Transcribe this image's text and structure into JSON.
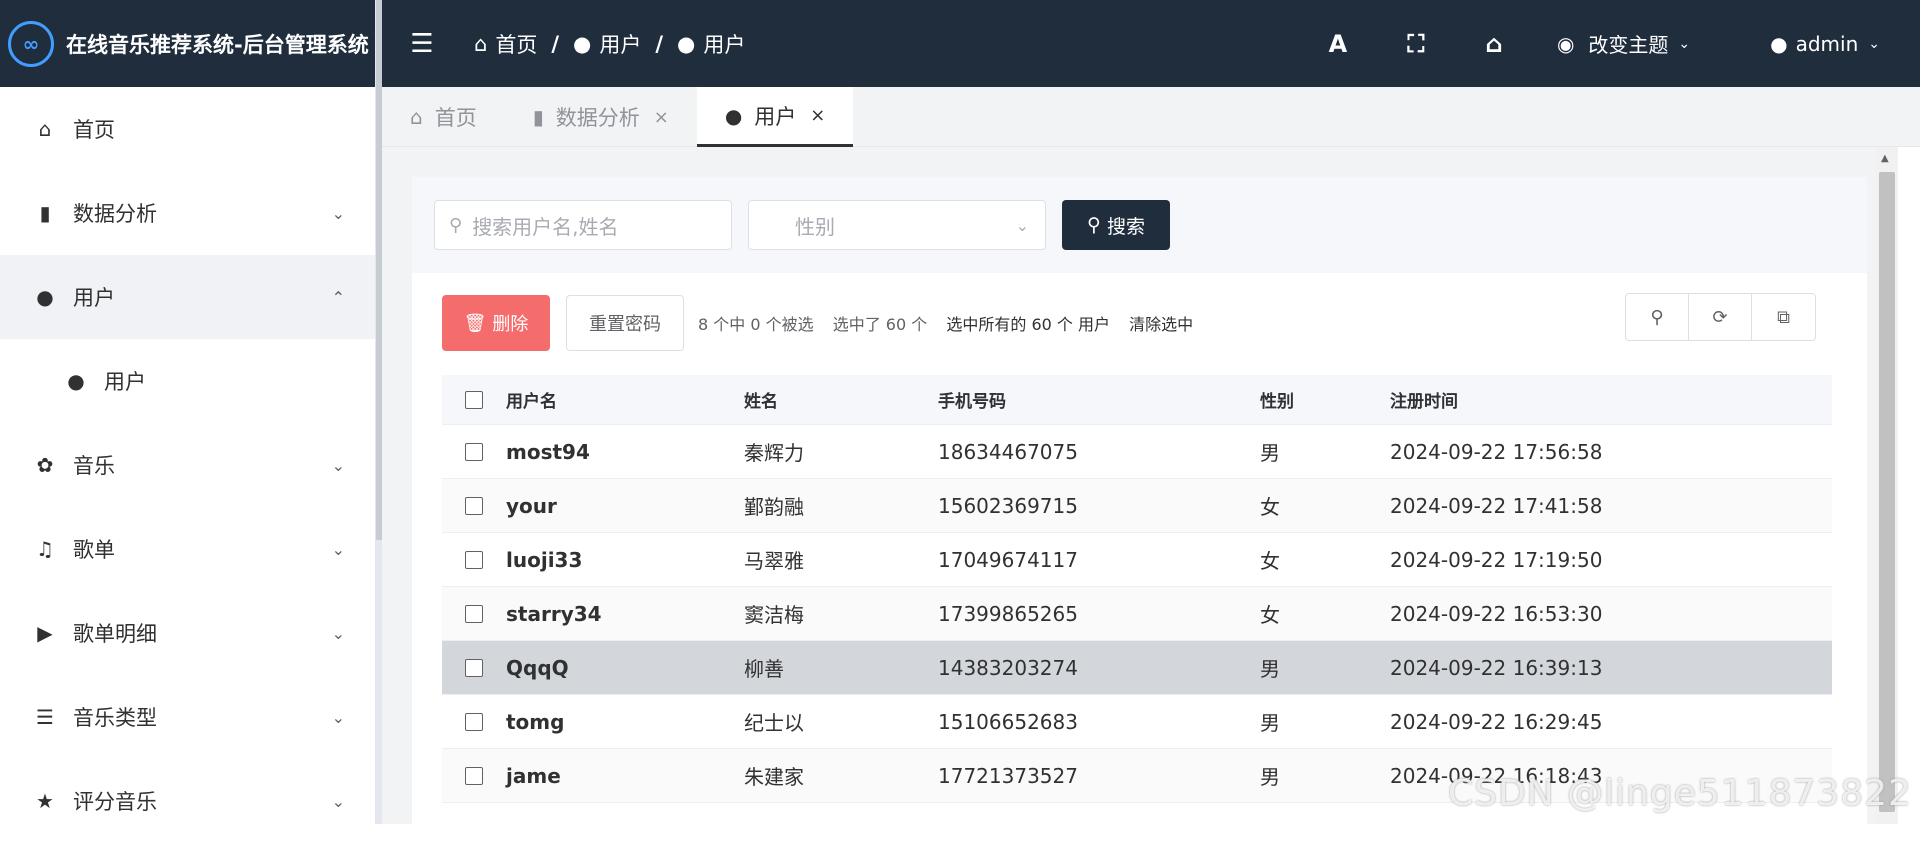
{
  "app": {
    "title": "在线音乐推荐系统-后台管理系统",
    "logo_text": "∞"
  },
  "sidebar": {
    "items": [
      {
        "label": "首页"
      },
      {
        "label": "数据分析"
      },
      {
        "label": "用户"
      },
      {
        "label": "用户"
      },
      {
        "label": "音乐"
      },
      {
        "label": "歌单"
      },
      {
        "label": "歌单明细"
      },
      {
        "label": "音乐类型"
      },
      {
        "label": "评分音乐"
      }
    ]
  },
  "topbar": {
    "menu_icon": "☰",
    "breadcrumb": [
      "首页",
      "用户",
      "用户"
    ],
    "breadcrumb_sep": "/",
    "btn_font": "A",
    "btn_fullscreen": "⛶",
    "btn_home": "⌂",
    "theme_label": "改变主题",
    "user_label": "admin"
  },
  "tabs": [
    {
      "label": "首页"
    },
    {
      "label": "数据分析"
    },
    {
      "label": "用户"
    }
  ],
  "filter": {
    "search_placeholder": "搜索用户名,姓名",
    "gender_placeholder": "性别",
    "search_button": "搜索"
  },
  "toolbar": {
    "delete_label": "删除",
    "reset_password_label": "重置密码",
    "selection_summary": "8 个中 0 个被选",
    "selected_count": "选中了 60 个",
    "select_all": "选中所有的 60 个 用户",
    "clear_selection": "清除选中"
  },
  "table": {
    "headers": [
      "用户名",
      "姓名",
      "手机号码",
      "性别",
      "注册时间"
    ],
    "rows": [
      [
        "most94",
        "秦辉力",
        "18634467075",
        "男",
        "2024-09-22 17:56:58"
      ],
      [
        "your",
        "鄞韵融",
        "15602369715",
        "女",
        "2024-09-22 17:41:58"
      ],
      [
        "luoji33",
        "马翠雅",
        "17049674117",
        "女",
        "2024-09-22 17:19:50"
      ],
      [
        "starry34",
        "窦洁梅",
        "17399865265",
        "女",
        "2024-09-22 16:53:30"
      ],
      [
        "QqqQ",
        "柳善",
        "14383203274",
        "男",
        "2024-09-22 16:39:13"
      ],
      [
        "tomg",
        "纪士以",
        "15106652683",
        "男",
        "2024-09-22 16:29:45"
      ],
      [
        "jame",
        "朱建家",
        "17721373527",
        "男",
        "2024-09-22 16:18:43"
      ]
    ]
  },
  "watermark": "CSDN @linge511873822"
}
